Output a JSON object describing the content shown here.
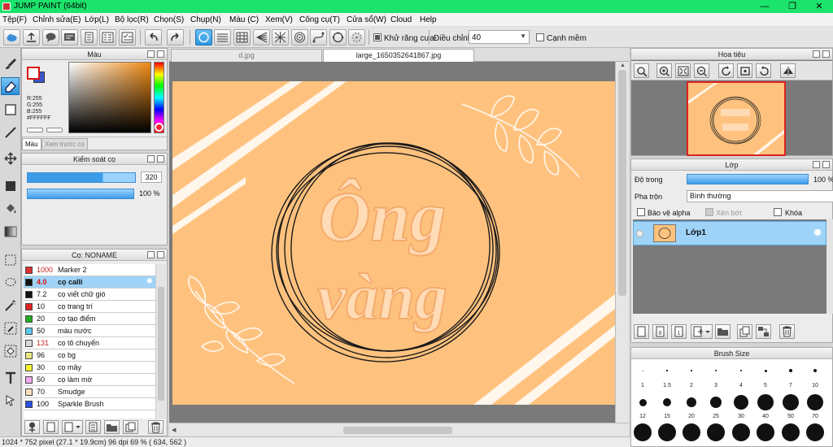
{
  "window": {
    "title": "JUMP PAINT (64bit)",
    "controls": [
      "—",
      "❐",
      "✕"
    ],
    "title_bar_color": "#1ce36c"
  },
  "menu": [
    "Tệp(F)",
    "Chỉnh sửa(E)",
    "Lớp(L)",
    "Bộ lọc(R)",
    "Chọn(S)",
    "Chụp(N)",
    "Màu (C)",
    "Xem(V)",
    "Công cụ(T)",
    "Cửa sổ(W)",
    "Cloud",
    "Help"
  ],
  "toolbar": {
    "antialias_label": "Khử răng cưa",
    "antialias_checked": true,
    "adjust_label": "Điều chỉnh",
    "adjust_value": "40",
    "edge_label": "Cạnh mềm",
    "edge_checked": false
  },
  "color_panel": {
    "title": "Màu",
    "rgb_lines": [
      "R:255",
      "G:255",
      "B:255",
      "#FFFFFF"
    ],
    "tabs": [
      "Màu",
      "Xem trước cọ"
    ],
    "active_tab": 0,
    "hue_color": "#f08a14"
  },
  "brush_control": {
    "title": "Kiểm soát cọ",
    "size_value": "320",
    "opacity_value": "100 %",
    "size_fraction": 0.7,
    "opacity_fraction": 1.0
  },
  "brush_list": {
    "title": "Cọ: NONAME",
    "items": [
      {
        "size": "1000",
        "name": "Marker 2",
        "color": "#e03030",
        "selected": false,
        "red": true
      },
      {
        "size": "4.0",
        "name": "cọ calli",
        "color": "#111111",
        "selected": true,
        "red": false
      },
      {
        "size": "7.2",
        "name": "cọ viết chữ gió",
        "color": "#111111",
        "selected": false,
        "red": false
      },
      {
        "size": "10",
        "name": "cọ trang trí",
        "color": "#e02020",
        "selected": false,
        "red": false
      },
      {
        "size": "20",
        "name": "cọ tạo điểm",
        "color": "#22b022",
        "selected": false,
        "red": false
      },
      {
        "size": "50",
        "name": "màu nước",
        "color": "#5ec8ee",
        "selected": false,
        "red": false
      },
      {
        "size": "131",
        "name": "cọ tô chuyển",
        "color": "#d8d8d8",
        "selected": false,
        "red": true
      },
      {
        "size": "96",
        "name": "cọ bg",
        "color": "#e8e882",
        "selected": false,
        "red": false
      },
      {
        "size": "30",
        "name": "cọ mây",
        "color": "#f2f230",
        "selected": false,
        "red": false
      },
      {
        "size": "50",
        "name": "cọ làm mờ",
        "color": "#f2a8f2",
        "selected": false,
        "red": false
      },
      {
        "size": "70",
        "name": "Smudge",
        "color": "#f6e0c0",
        "selected": false,
        "red": false
      },
      {
        "size": "100",
        "name": "Sparkle Brush",
        "color": "#2850e0",
        "selected": false,
        "red": false
      }
    ]
  },
  "documents": {
    "tabs": [
      "d.jpg",
      "large_1650352641867.jpg"
    ],
    "active_tab": 1
  },
  "navigator": {
    "title": "Hoa tiêu"
  },
  "layers": {
    "title": "Lớp",
    "opacity_label": "Độ trong",
    "opacity_value": "100 %",
    "blend_label": "Pha trộn",
    "blend_value": "Bình thường",
    "protect_alpha_label": "Bảo vệ alpha",
    "clip_label": "Xén bớt",
    "lock_label": "Khóa",
    "layer_name": "Lớp1"
  },
  "brush_size": {
    "title": "Brush Size",
    "row1_labels": [
      "1",
      "1.5",
      "2",
      "3",
      "4",
      "5",
      "7",
      "10"
    ],
    "row2_labels": [
      "12",
      "15",
      "20",
      "25",
      "30",
      "40",
      "50",
      "70"
    ]
  },
  "artwork": {
    "text_line1": "Ông",
    "text_line2": "vàng",
    "background": "#ffc27e"
  },
  "status": "1024 * 752 pixel  (27.1 * 19.9cm)  96 dpi  69 %  ( 634, 562 )"
}
